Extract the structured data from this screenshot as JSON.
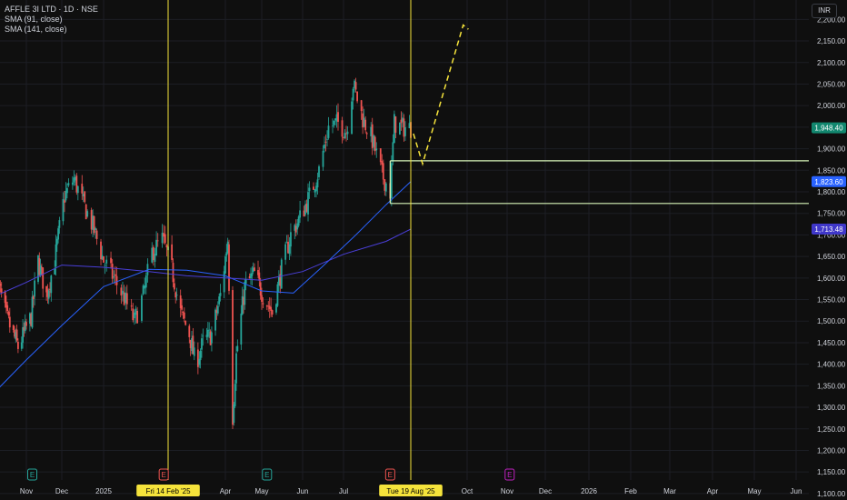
{
  "legend": {
    "symbol_line": "AFFLE 3I LTD · 1D · NSE",
    "sma1_label": "SMA (91, close)",
    "sma2_label": "SMA (141, close)"
  },
  "currency_button": "INR",
  "colors": {
    "background": "#0f0f0f",
    "grid": "#1c1e24",
    "candle_up": "#26a69a",
    "candle_down": "#ef5350",
    "sma91": "#2962ff",
    "sma141": "#4a3fd9",
    "vertical_marker": "#f5e33b",
    "support_lines": "#d7f5b8",
    "projection": "#f5e33b",
    "price_tag": "#12876f",
    "sma91_tag": "#2962ff",
    "sma141_tag": "#3f37c9"
  },
  "chart_data": {
    "type": "candlestick",
    "title": "AFFLE 3I LTD · 1D · NSE",
    "currency": "INR",
    "x_tick_labels": [
      "Nov",
      "Dec",
      "2025",
      "Fri 14 Feb '25",
      "Apr",
      "May",
      "Jun",
      "Jul",
      "Tue 19 Aug '25",
      "Oct",
      "Nov",
      "Dec",
      "2026",
      "Feb",
      "Mar",
      "Apr",
      "May",
      "Jun"
    ],
    "y_ticks": [
      1100,
      1150,
      1200,
      1250,
      1300,
      1350,
      1400,
      1450,
      1500,
      1550,
      1600,
      1650,
      1700,
      1750,
      1800,
      1850,
      1900,
      1950,
      2000,
      2050,
      2100,
      2150,
      2200
    ],
    "y_tick_labels": [
      "1,100.00",
      "1,150.00",
      "1,200.00",
      "1,250.00",
      "1,300.00",
      "1,350.00",
      "1,400.00",
      "1,450.00",
      "1,500.00",
      "1,550.00",
      "1,600.00",
      "1,650.00",
      "1,700.00",
      "1,750.00",
      "1,800.00",
      "1,850.00",
      "1,900.00",
      "1,950.00",
      "2,000.00",
      "2,050.00",
      "2,100.00",
      "2,150.00",
      "2,200.00"
    ],
    "ylim": [
      1085,
      2245
    ],
    "last_price": {
      "value": 1948.4,
      "label": "1,948.40"
    },
    "sma_tags": [
      {
        "name": "SMA (91, close)",
        "value": 1823.6,
        "label": "1,823.60"
      },
      {
        "name": "SMA (141, close)",
        "value": 1713.48,
        "label": "1,713.48"
      }
    ],
    "vertical_markers": [
      "2025-02-14",
      "2025-08-19"
    ],
    "horizontal_levels": [
      {
        "value": 1872,
        "from": "2025-08-04"
      },
      {
        "value": 1773,
        "from": "2025-08-04"
      }
    ],
    "projection_path": [
      {
        "x": "2025-08-21",
        "y": 1935
      },
      {
        "x": "2025-08-28",
        "y": 1865
      },
      {
        "x": "2025-09-28",
        "y": 2187
      },
      {
        "x": "2025-10-02",
        "y": 2177
      }
    ],
    "event_markers": [
      {
        "date": "2024-11-06",
        "letter": "E",
        "color": "#26a69a"
      },
      {
        "date": "2025-02-11",
        "letter": "E",
        "color": "#ef5350"
      },
      {
        "date": "2025-05-05",
        "letter": "E",
        "color": "#26a69a"
      },
      {
        "date": "2025-08-04",
        "letter": "E",
        "color": "#ef5350"
      },
      {
        "date": "2025-11-03",
        "letter": "E",
        "color": "#c020c0"
      }
    ],
    "price_path": [
      [
        "2024-10-07",
        1600
      ],
      [
        "2024-10-15",
        1510
      ],
      [
        "2024-10-25",
        1440
      ],
      [
        "2024-11-05",
        1510
      ],
      [
        "2024-11-11",
        1640
      ],
      [
        "2024-11-18",
        1560
      ],
      [
        "2024-11-25",
        1640
      ],
      [
        "2024-12-03",
        1790
      ],
      [
        "2024-12-10",
        1830
      ],
      [
        "2024-12-16",
        1780
      ],
      [
        "2024-12-24",
        1720
      ],
      [
        "2025-01-01",
        1640
      ],
      [
        "2025-01-08",
        1600
      ],
      [
        "2025-01-14",
        1560
      ],
      [
        "2025-01-22",
        1500
      ],
      [
        "2025-01-28",
        1560
      ],
      [
        "2025-02-03",
        1660
      ],
      [
        "2025-02-10",
        1690
      ],
      [
        "2025-02-17",
        1620
      ],
      [
        "2025-02-24",
        1520
      ],
      [
        "2025-03-03",
        1470
      ],
      [
        "2025-03-08",
        1400
      ],
      [
        "2025-03-14",
        1450
      ],
      [
        "2025-03-21",
        1470
      ],
      [
        "2025-03-28",
        1560
      ],
      [
        "2025-04-03",
        1690
      ],
      [
        "2025-04-07",
        1280
      ],
      [
        "2025-04-10",
        1420
      ],
      [
        "2025-04-17",
        1580
      ],
      [
        "2025-04-25",
        1610
      ],
      [
        "2025-05-02",
        1560
      ],
      [
        "2025-05-09",
        1520
      ],
      [
        "2025-05-16",
        1620
      ],
      [
        "2025-05-23",
        1700
      ],
      [
        "2025-05-30",
        1740
      ],
      [
        "2025-06-06",
        1790
      ],
      [
        "2025-06-13",
        1850
      ],
      [
        "2025-06-20",
        1950
      ],
      [
        "2025-06-27",
        1960
      ],
      [
        "2025-07-03",
        1940
      ],
      [
        "2025-07-08",
        2050
      ],
      [
        "2025-07-15",
        1970
      ],
      [
        "2025-07-22",
        1920
      ],
      [
        "2025-07-29",
        1840
      ],
      [
        "2025-08-04",
        1800
      ],
      [
        "2025-08-07",
        1960
      ],
      [
        "2025-08-12",
        1950
      ],
      [
        "2025-08-19",
        1948
      ]
    ],
    "sma91_path": [
      [
        "2024-10-07",
        1340
      ],
      [
        "2024-11-01",
        1410
      ],
      [
        "2024-12-01",
        1490
      ],
      [
        "2025-01-01",
        1580
      ],
      [
        "2025-02-01",
        1620
      ],
      [
        "2025-03-01",
        1618
      ],
      [
        "2025-04-01",
        1605
      ],
      [
        "2025-05-01",
        1570
      ],
      [
        "2025-05-25",
        1565
      ],
      [
        "2025-06-15",
        1625
      ],
      [
        "2025-07-10",
        1700
      ],
      [
        "2025-08-01",
        1770
      ],
      [
        "2025-08-19",
        1823.6
      ]
    ],
    "sma141_path": [
      [
        "2024-10-07",
        1560
      ],
      [
        "2024-11-01",
        1590
      ],
      [
        "2024-12-01",
        1630
      ],
      [
        "2025-01-01",
        1625
      ],
      [
        "2025-02-01",
        1615
      ],
      [
        "2025-03-01",
        1605
      ],
      [
        "2025-04-01",
        1600
      ],
      [
        "2025-05-01",
        1595
      ],
      [
        "2025-06-01",
        1615
      ],
      [
        "2025-07-01",
        1655
      ],
      [
        "2025-08-01",
        1685
      ],
      [
        "2025-08-19",
        1713.48
      ]
    ]
  }
}
